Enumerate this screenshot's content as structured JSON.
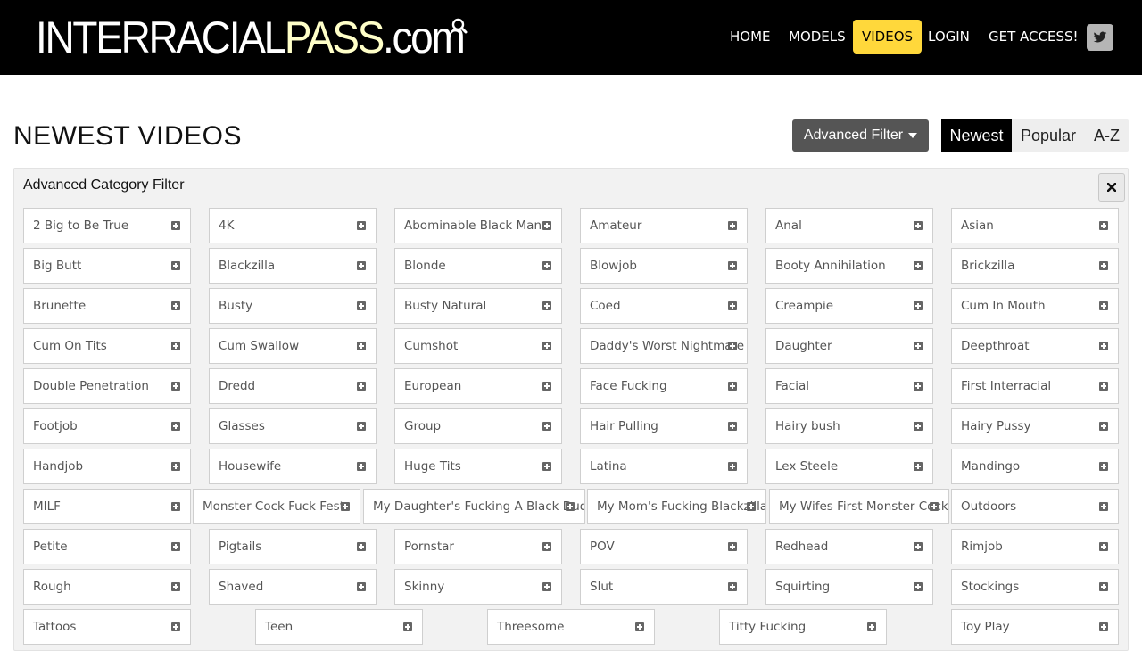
{
  "header": {
    "logo": {
      "part1": "INTERRACIAL",
      "part2": "PASS",
      "part3": ".com"
    },
    "nav": [
      {
        "label": "HOME",
        "active": false
      },
      {
        "label": "MODELS",
        "active": false
      },
      {
        "label": "VIDEOS",
        "active": true
      },
      {
        "label": "LOGIN",
        "active": false
      },
      {
        "label": "GET ACCESS!",
        "active": false
      }
    ],
    "social_icon": "twitter-icon",
    "search_icon": "search-icon"
  },
  "main": {
    "title": "NEWEST VIDEOS",
    "advanced_filter_label": "Advanced Filter",
    "sort": [
      {
        "label": "Newest",
        "active": true
      },
      {
        "label": "Popular",
        "active": false
      },
      {
        "label": "A-Z",
        "active": false
      }
    ]
  },
  "filter": {
    "title": "Advanced Category Filter",
    "categories": [
      "2 Big to Be True",
      "4K",
      "Abominable Black Man",
      "Amateur",
      "Anal",
      "Asian",
      "Big Butt",
      "Blackzilla",
      "Blonde",
      "Blowjob",
      "Booty Annihilation",
      "Brickzilla",
      "Brunette",
      "Busty",
      "Busty Natural",
      "Coed",
      "Creampie",
      "Cum In Mouth",
      "Cum On Tits",
      "Cum Swallow",
      "Cumshot",
      "Daddy's Worst Nightmare",
      "Daughter",
      "Deepthroat",
      "Double Penetration",
      "Dredd",
      "European",
      "Face Fucking",
      "Facial",
      "First Interracial",
      "Footjob",
      "Glasses",
      "Group",
      "Hair Pulling",
      "Hairy bush",
      "Hairy Pussy",
      "Handjob",
      "Housewife",
      "Huge Tits",
      "Latina",
      "Lex Steele",
      "Mandingo",
      "MILF",
      "Monster Cock Fuck Fest",
      "My Daughter's Fucking A Black Dude",
      "My Mom's Fucking Blackzilla",
      "My Wifes First Monster Cock",
      "Outdoors",
      "Petite",
      "Pigtails",
      "Pornstar",
      "POV",
      "Redhead",
      "Rimjob",
      "Rough",
      "Shaved",
      "Skinny",
      "Slut",
      "Squirting",
      "Stockings",
      "Tattoos",
      "Teen",
      "Threesome",
      "Titty Fucking",
      "Toy Play"
    ]
  },
  "colors": {
    "header_bg": "#000000",
    "accent": "#ffd83b",
    "logo_highlight": "#ffffc8"
  }
}
